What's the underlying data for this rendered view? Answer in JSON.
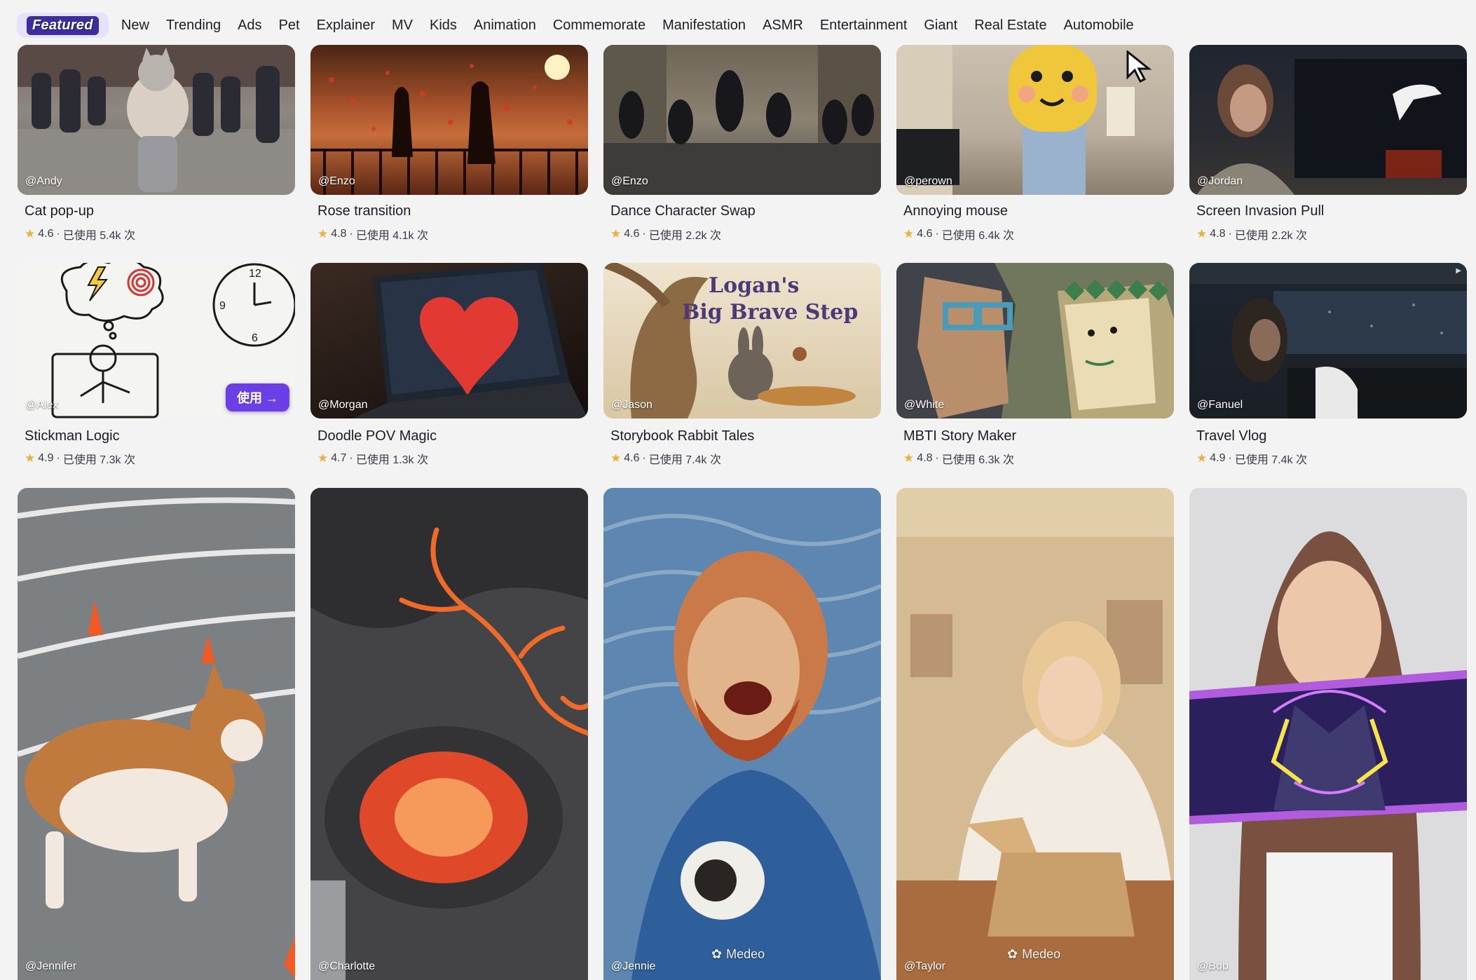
{
  "nav": {
    "active": "Featured",
    "items": [
      "New",
      "Trending",
      "Ads",
      "Pet",
      "Explainer",
      "MV",
      "Kids",
      "Animation",
      "Commemorate",
      "Manifestation",
      "ASMR",
      "Entertainment",
      "Giant",
      "Real Estate",
      "Automobile"
    ]
  },
  "row1": [
    {
      "handle": "@Andy",
      "title": "Cat pop-up",
      "rating": "4.6",
      "usage": "已使用 5.4k 次"
    },
    {
      "handle": "@Enzo",
      "title": "Rose transition",
      "rating": "4.8",
      "usage": "已使用 4.1k 次"
    },
    {
      "handle": "@Enzo",
      "title": "Dance Character Swap",
      "rating": "4.6",
      "usage": "已使用 2.2k 次"
    },
    {
      "handle": "@perown",
      "title": "Annoying mouse",
      "rating": "4.6",
      "usage": "已使用 6.4k 次"
    },
    {
      "handle": "@Jordan",
      "title": "Screen Invasion Pull",
      "rating": "4.8",
      "usage": "已使用 2.2k 次"
    }
  ],
  "row2": [
    {
      "handle": "@Alex",
      "title": "Stickman Logic",
      "rating": "4.9",
      "usage": "已使用 7.3k 次",
      "button": "使用 →"
    },
    {
      "handle": "@Morgan",
      "title": "Doodle POV Magic",
      "rating": "4.7",
      "usage": "已使用 1.3k 次"
    },
    {
      "handle": "@Jason",
      "title": "Storybook Rabbit Tales",
      "rating": "4.6",
      "usage": "已使用 7.4k 次",
      "art_text_1": "Logan's",
      "art_text_2": "Big Brave Step"
    },
    {
      "handle": "@White",
      "title": "MBTI Story Maker",
      "rating": "4.8",
      "usage": "已使用 6.3k 次"
    },
    {
      "handle": "@Fanuel",
      "title": "Travel Vlog",
      "rating": "4.9",
      "usage": "已使用 7.4k 次"
    }
  ],
  "row3": [
    {
      "handle": "@Jennifer"
    },
    {
      "handle": "@Charlotte"
    },
    {
      "handle": "@Jennie",
      "watermark": "Medeo"
    },
    {
      "handle": "@Taylor",
      "watermark": "Medeo"
    },
    {
      "handle": "@Bob"
    }
  ],
  "colors": {
    "accent": "#6b3fe6",
    "star": "#e8b33a",
    "bg": "#f3f3f4"
  }
}
